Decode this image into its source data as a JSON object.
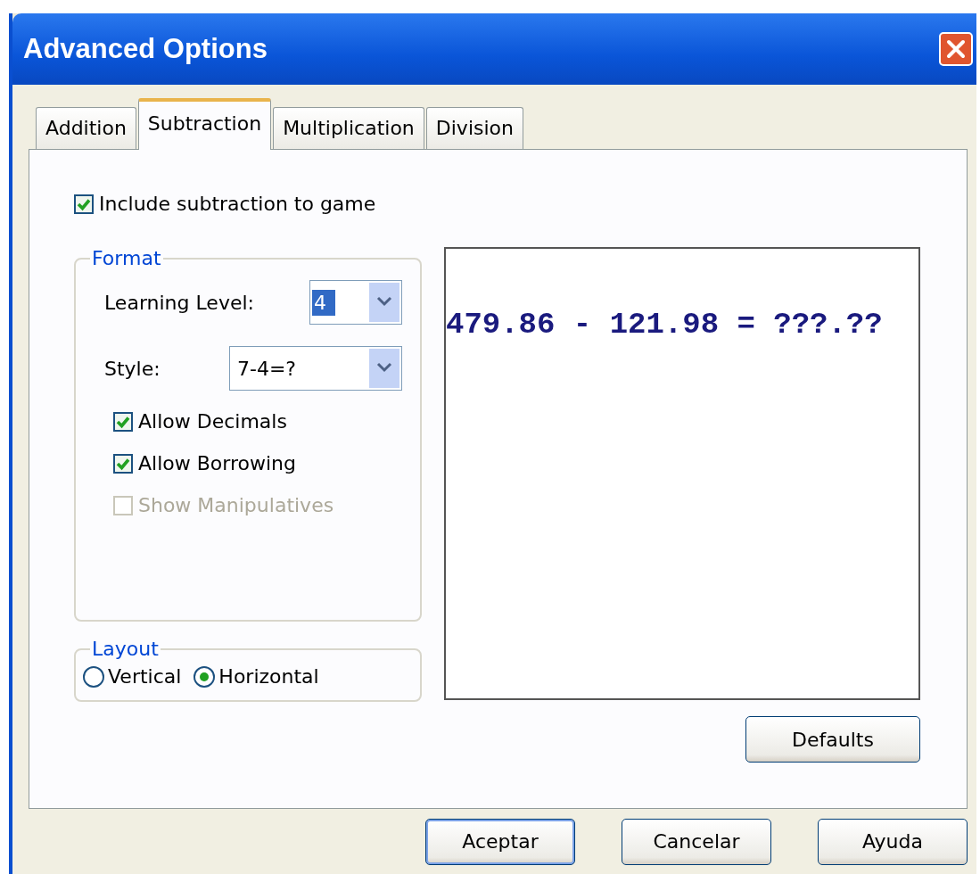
{
  "window": {
    "title": "Advanced Options"
  },
  "tabs": [
    {
      "label": "Addition",
      "selected": false
    },
    {
      "label": "Subtraction",
      "selected": true
    },
    {
      "label": "Multiplication",
      "selected": false
    },
    {
      "label": "Division",
      "selected": false
    }
  ],
  "include_checkbox": {
    "label": "Include subtraction to game",
    "checked": true
  },
  "format": {
    "title": "Format",
    "learning_level": {
      "label": "Learning Level:",
      "value": "4"
    },
    "style": {
      "label": "Style:",
      "value": "7-4=?"
    },
    "options": [
      {
        "label": "Allow Decimals",
        "checked": true,
        "disabled": false
      },
      {
        "label": "Allow Borrowing",
        "checked": true,
        "disabled": false
      },
      {
        "label": "Show Manipulatives",
        "checked": false,
        "disabled": true
      }
    ]
  },
  "layout": {
    "title": "Layout",
    "options": [
      {
        "label": "Vertical",
        "selected": false
      },
      {
        "label": "Horizontal",
        "selected": true
      }
    ]
  },
  "preview": {
    "text": "479.86 - 121.98 = ???.??"
  },
  "defaults_button": {
    "label": "Defaults"
  },
  "buttons": [
    {
      "label": "Aceptar",
      "focused": true
    },
    {
      "label": "Cancelar",
      "focused": false
    },
    {
      "label": "Ayuda",
      "focused": false
    }
  ]
}
